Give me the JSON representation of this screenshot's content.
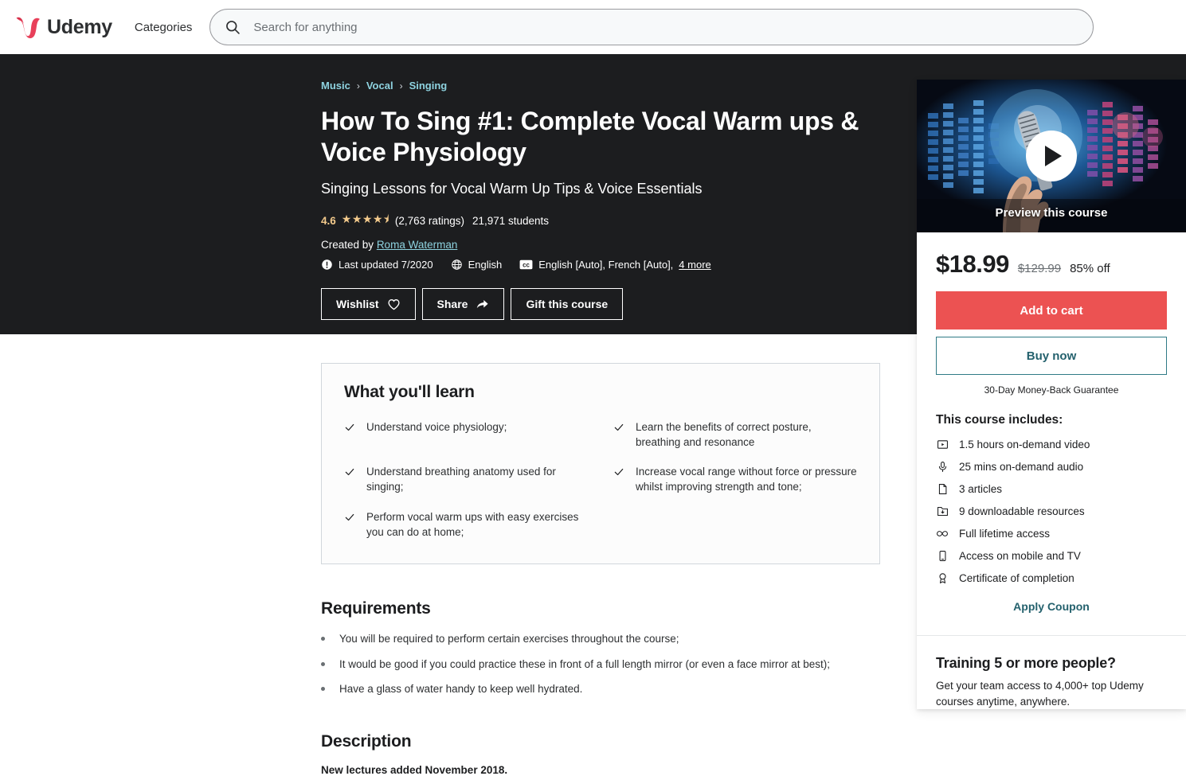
{
  "header": {
    "logo_text": "Udemy",
    "logo_icon": "udemy-u-logo",
    "categories_label": "Categories",
    "search_placeholder": "Search for anything",
    "search_value": "",
    "search_icon": "search-icon"
  },
  "breadcrumb": [
    {
      "label": "Music"
    },
    {
      "label": "Vocal"
    },
    {
      "label": "Singing"
    }
  ],
  "breadcrumb_separator": "›",
  "course": {
    "title": "How To Sing #1: Complete Vocal Warm ups & Voice Physiology",
    "headline": "Singing Lessons for Vocal Warm Up Tips & Voice Essentials",
    "rating": "4.6",
    "stars": "★★★★⯨",
    "ratings_count": "(2,763 ratings)",
    "students": "21,971 students",
    "created_by_label": "Created by",
    "instructor": "Roma Waterman",
    "last_updated": "Last updated 7/2020",
    "last_updated_icon": "exclamation-circle-icon",
    "language": "English",
    "language_icon": "globe-icon",
    "captions_icon": "closed-caption-icon",
    "captions": "English [Auto], French [Auto],",
    "captions_more": "4 more"
  },
  "hero_buttons": [
    {
      "label": "Wishlist",
      "icon": "heart-icon",
      "name": "wishlist-button"
    },
    {
      "label": "Share",
      "icon": "share-arrow-icon",
      "name": "share-button"
    },
    {
      "label": "Gift this course",
      "icon": "",
      "name": "gift-course-button"
    }
  ],
  "preview": {
    "label": "Preview this course",
    "play_icon": "play-icon",
    "alt": "hand holding microphone with colorful equalizer lights"
  },
  "pricing": {
    "current": "$18.99",
    "original": "$129.99",
    "discount": "85% off",
    "add_to_cart_label": "Add to cart",
    "buy_now_label": "Buy now",
    "guarantee": "30-Day Money-Back Guarantee",
    "add_to_cart_color": "#ec5252",
    "buy_now_color": "#24616d"
  },
  "includes": {
    "title": "This course includes:",
    "items": [
      {
        "icon": "video-play-icon",
        "label": "1.5 hours on-demand video"
      },
      {
        "icon": "microphone-icon",
        "label": "25 mins on-demand audio"
      },
      {
        "icon": "document-icon",
        "label": "3 articles"
      },
      {
        "icon": "download-box-icon",
        "label": "9 downloadable resources"
      },
      {
        "icon": "infinity-icon",
        "label": "Full lifetime access"
      },
      {
        "icon": "mobile-phone-icon",
        "label": "Access on mobile and TV"
      },
      {
        "icon": "trophy-badge-icon",
        "label": "Certificate of completion"
      }
    ]
  },
  "apply_coupon_label": "Apply Coupon",
  "training": {
    "title": "Training 5 or more people?",
    "text": "Get your team access to 4,000+ top Udemy courses anytime, anywhere."
  },
  "what_you_learn": {
    "title": "What you'll learn",
    "items": [
      "Understand voice physiology;",
      "Learn the benefits of correct posture, breathing and resonance",
      "Understand breathing anatomy used for singing;",
      "Increase vocal range without force or pressure whilst improving strength and tone;",
      "Perform vocal warm ups with easy exercises you can do at home;"
    ]
  },
  "requirements": {
    "title": "Requirements",
    "items": [
      "You will be required to perform certain exercises throughout the course;",
      "It would be good if you could practice these in front of a full length mirror (or even a face mirror at best);",
      "Have a glass of water handy to keep well hydrated."
    ]
  },
  "description": {
    "title": "Description",
    "first_line": "New lectures added November 2018."
  },
  "colors": {
    "hero_bg": "#1c1d1f",
    "link_blue": "#8ed3e0",
    "accent_red": "#ec5252",
    "teal": "#24616d",
    "star_gold": "#f3ca8c"
  }
}
